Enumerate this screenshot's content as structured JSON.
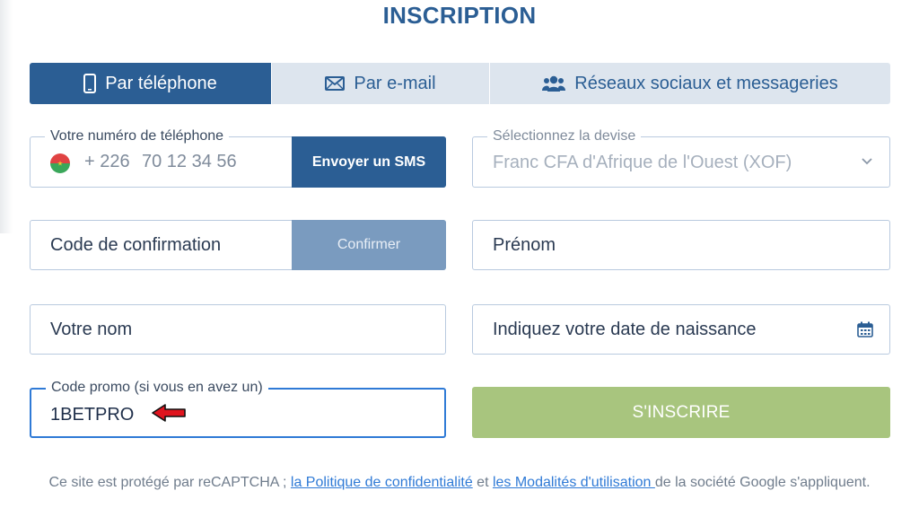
{
  "page": {
    "title": "INSCRIPTION"
  },
  "tabs": [
    {
      "label": "Par téléphone",
      "icon": "phone-icon",
      "active": true
    },
    {
      "label": "Par e-mail",
      "icon": "envelope-icon",
      "active": false
    },
    {
      "label": "Réseaux sociaux et messageries",
      "icon": "users-icon",
      "active": false
    }
  ],
  "phone": {
    "legend": "Votre numéro de téléphone",
    "prefix": "+ 226",
    "placeholder": "70 12 34 56",
    "flag": "burkina-faso-flag-icon",
    "sms_button": "Envoyer un SMS"
  },
  "currency": {
    "legend": "Sélectionnez la devise",
    "value": "Franc CFA d'Afrique de l'Ouest (XOF)"
  },
  "confirmation": {
    "placeholder": "Code de confirmation",
    "button": "Confirmer"
  },
  "first_name": {
    "placeholder": "Prénom"
  },
  "last_name": {
    "placeholder": "Votre nom"
  },
  "birth_date": {
    "placeholder": "Indiquez votre date de naissance",
    "icon": "calendar-icon"
  },
  "promo": {
    "legend": "Code promo (si vous en avez un)",
    "value": "1BETPRO"
  },
  "submit": {
    "label": "S'INSCRIRE"
  },
  "footer": {
    "text_before": "Ce site est protégé par reCAPTCHA ; ",
    "privacy_link": "la Politique de confidentialité",
    "text_and": " et ",
    "terms_link": "les Modalités d'utilisation ",
    "text_after": "de la société Google s'appliquent."
  },
  "colors": {
    "primary": "#2b5e94",
    "tab_inactive": "#dde5ee",
    "confirm_disabled": "#7a9bbf",
    "submit": "#a8c57e",
    "focus": "#2f7ad6",
    "annotation_arrow": "#e0141e"
  }
}
